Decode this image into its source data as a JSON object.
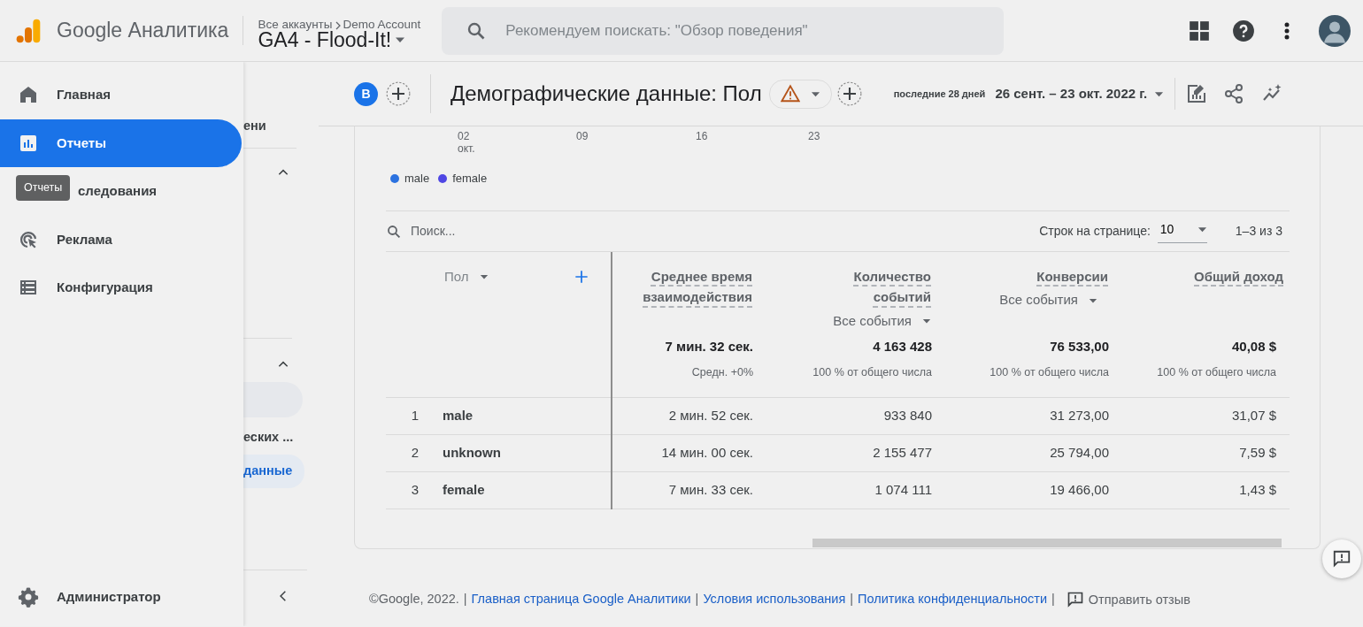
{
  "header": {
    "logo_text": "Google Аналитика",
    "breadcrumb": [
      "Все аккаунты",
      "Demo Account"
    ],
    "property": "GA4 - Flood-It!",
    "search": {
      "placeholder": "Рекомендуем поискать: \"Обзор поведения\""
    }
  },
  "drawer": {
    "items": [
      {
        "label": "Главная",
        "kind": "home",
        "selected": false
      },
      {
        "label": "Отчеты",
        "kind": "reports",
        "selected": true
      },
      {
        "label": "следования",
        "kind": "explore",
        "selected": false
      },
      {
        "label": "Реклама",
        "kind": "ads",
        "selected": false
      },
      {
        "label": "Конфигурация",
        "kind": "config",
        "selected": false
      }
    ],
    "admin": {
      "label": "Администратор"
    }
  },
  "tooltip": "Отчеты",
  "secondary_nav": {
    "items": [
      {
        "label": "ени",
        "selected": false
      },
      {
        "label": "еских ...",
        "selected": false
      },
      {
        "label": "данные",
        "selected": true
      }
    ]
  },
  "toolbar": {
    "comparison_badge": "В",
    "title": "Демографические данные: Пол",
    "range_label": "последние 28 дней",
    "date_range": "26 сент. – 23 окт. 2022 г."
  },
  "chart": {
    "x_labels": [
      {
        "label": "02",
        "sub": "окт."
      },
      {
        "label": "09"
      },
      {
        "label": "16"
      },
      {
        "label": "23"
      }
    ],
    "legend": [
      {
        "label": "male",
        "color": "#2b72e0"
      },
      {
        "label": "female",
        "color": "#4f47e4"
      }
    ]
  },
  "table": {
    "search": {
      "placeholder": "Поиск..."
    },
    "rows_per_page_label": "Строк на странице:",
    "rows_per_page": "10",
    "pagination": "1–3 из 3",
    "dimension": "Пол",
    "columns": [
      {
        "title": "Среднее время взаимодействия"
      },
      {
        "title": "Количество событий",
        "filter": "Все события"
      },
      {
        "title": "Конверсии",
        "filter": "Все события"
      },
      {
        "title": "Общий доход"
      }
    ],
    "totals": [
      {
        "value": "7 мин. 32 сек.",
        "note": "Средн. +0%"
      },
      {
        "value": "4 163 428",
        "note": "100 % от общего числа"
      },
      {
        "value": "76 533,00",
        "note": "100 % от общего числа"
      },
      {
        "value": "40,08 $",
        "note": "100 % от общего числа"
      }
    ],
    "rows": [
      {
        "rank": "1",
        "dimension": "male",
        "values": [
          "2 мин. 52 сек.",
          "933 840",
          "31 273,00",
          "31,07 $"
        ]
      },
      {
        "rank": "2",
        "dimension": "unknown",
        "values": [
          "14 мин. 00 сек.",
          "2 155 477",
          "25 794,00",
          "7,59 $"
        ]
      },
      {
        "rank": "3",
        "dimension": "female",
        "values": [
          "7 мин. 33 сек.",
          "1 074 111",
          "19 466,00",
          "1,43 $"
        ]
      }
    ]
  },
  "footer": {
    "copyright": "©Google, 2022.",
    "separator": "|",
    "links": [
      "Главная страница Google Аналитики",
      "Условия использования",
      "Политика конфиденциальности"
    ],
    "feedback": "Отправить отзыв"
  }
}
